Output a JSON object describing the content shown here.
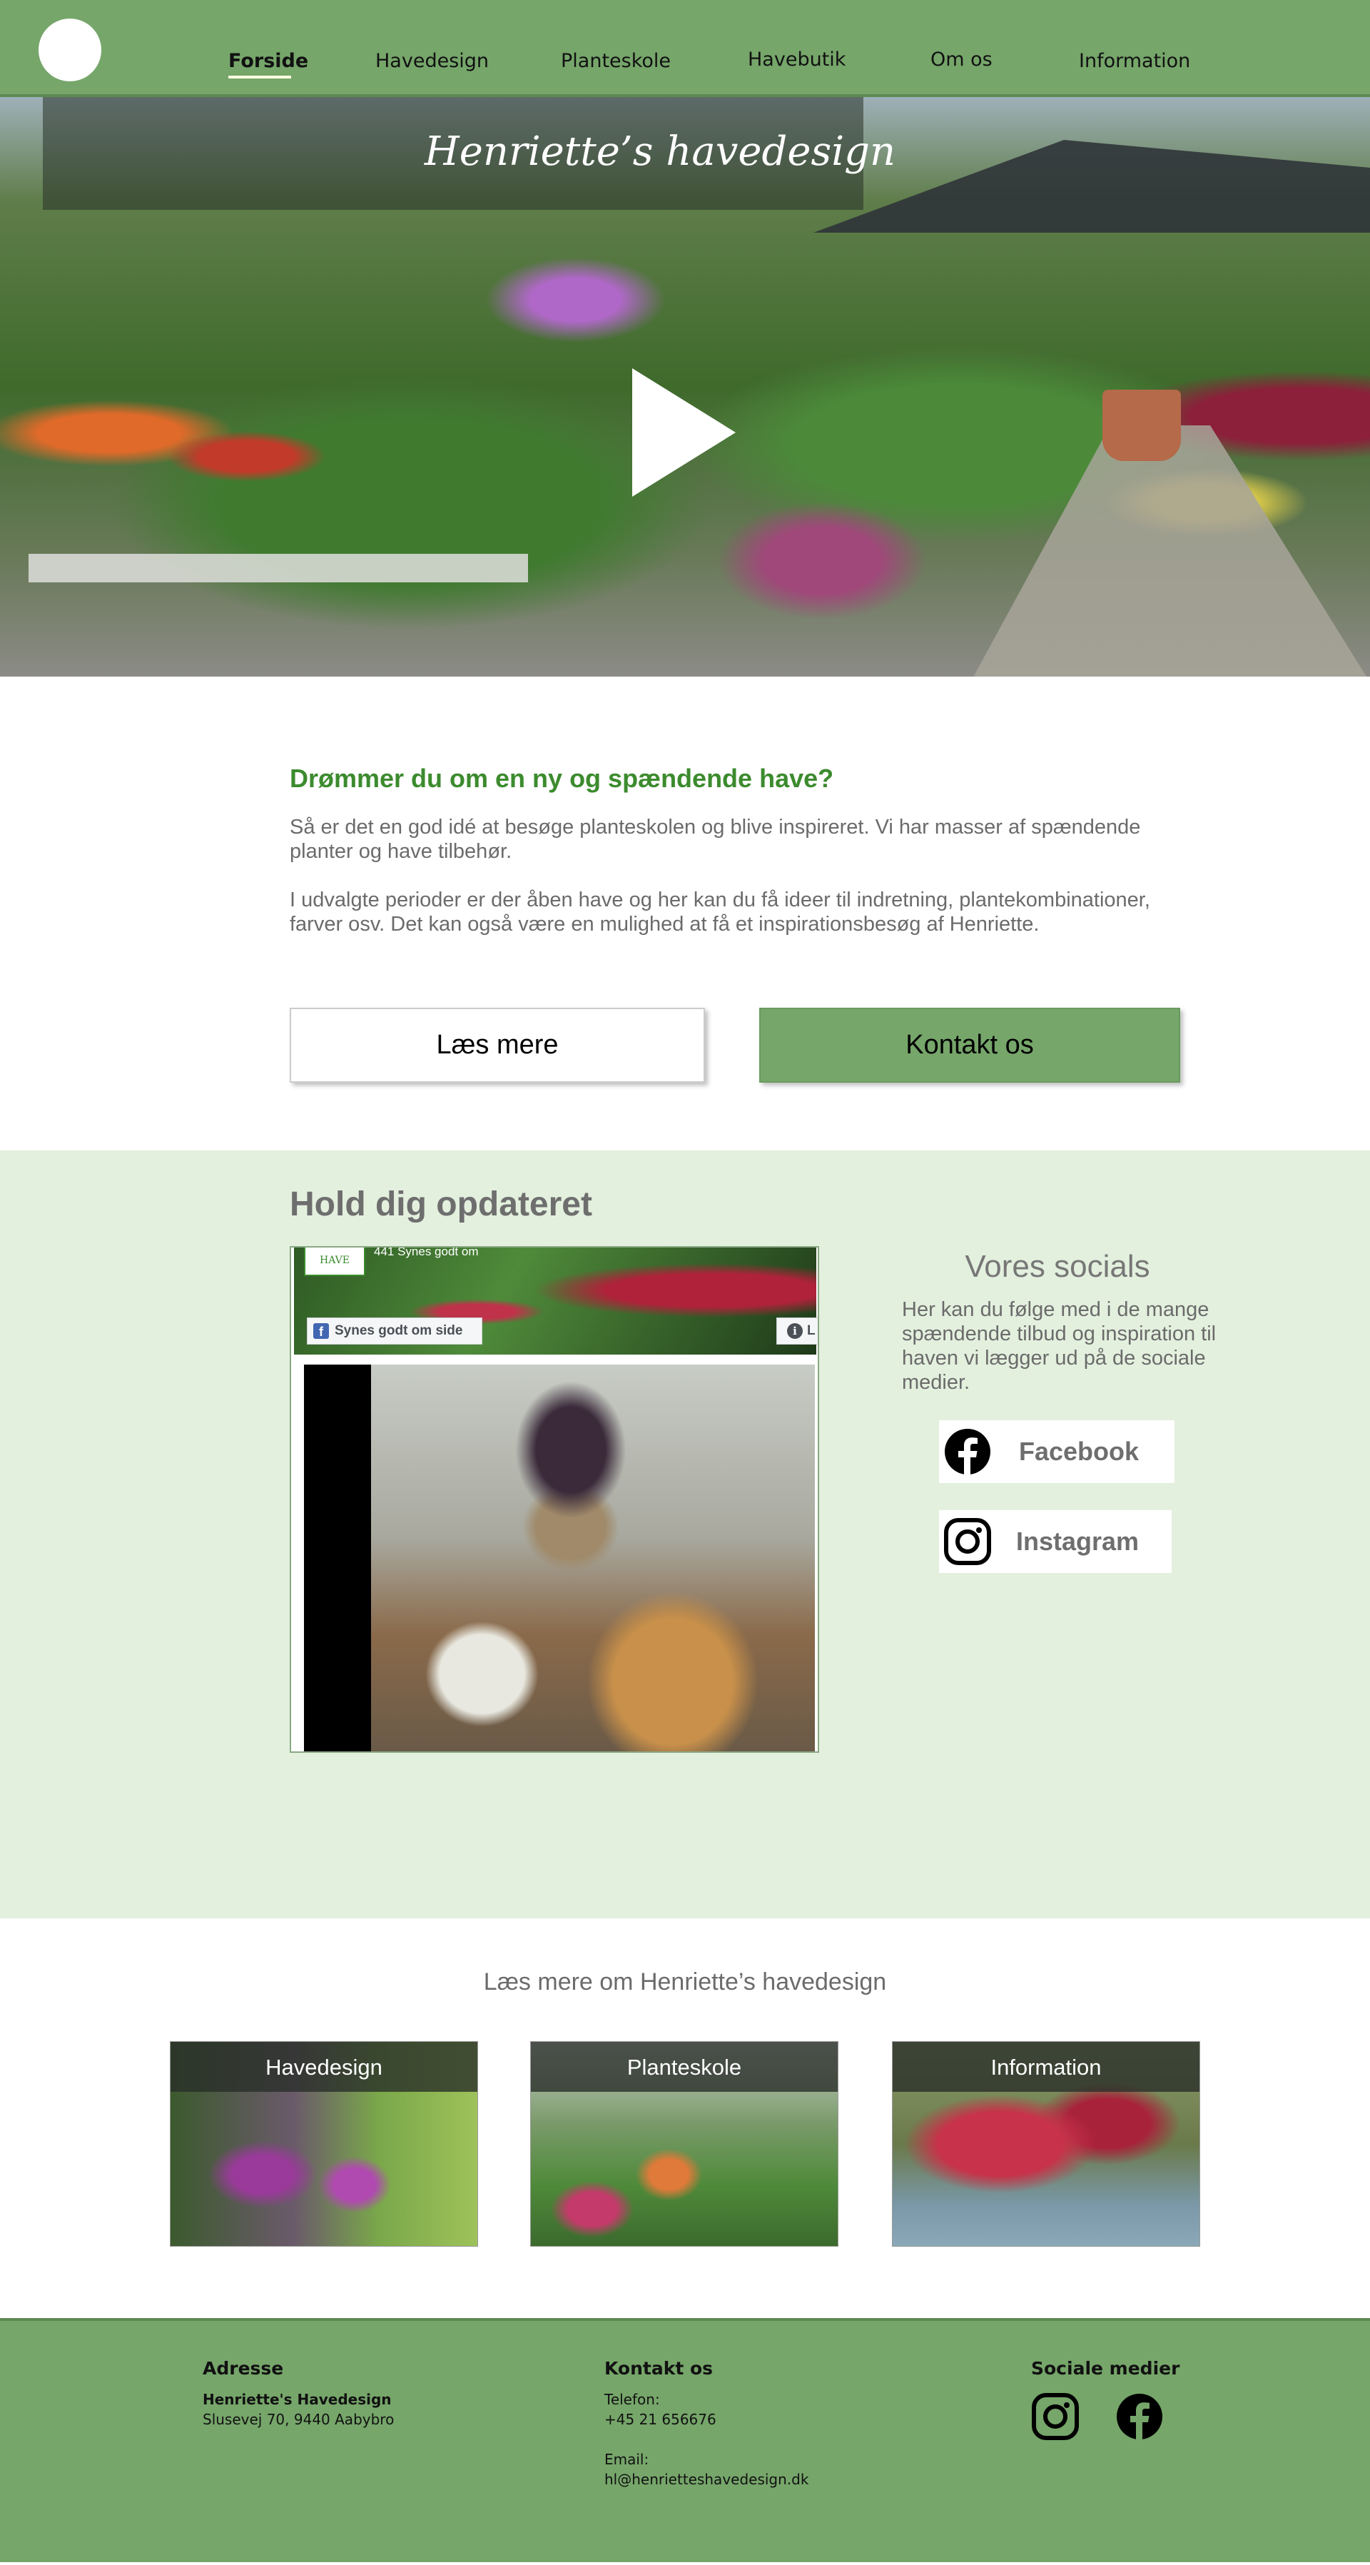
{
  "nav": {
    "items": [
      {
        "label": "Forside",
        "active": true
      },
      {
        "label": "Havedesign"
      },
      {
        "label": "Planteskole"
      },
      {
        "label": "Havebutik"
      },
      {
        "label": "Om os"
      },
      {
        "label": "Information"
      }
    ]
  },
  "hero": {
    "title": "Henriette’s havedesign",
    "play_icon": "play-icon"
  },
  "intro": {
    "heading": "Drømmer du om en ny og spændende have?",
    "paragraph1": "Så er det en god idé at besøge planteskolen og blive inspireret. Vi har masser af spændende planter og have tilbehør.",
    "paragraph2": "I udvalgte perioder er der åben have og her kan du få ideer til indretning, plantekombinationer, farver osv. Det kan også være en mulighed at få et inspirationsbesøg af Henriette.",
    "read_more_label": "Læs mere",
    "contact_label": "Kontakt os"
  },
  "updates": {
    "title": "Hold dig opdateret",
    "facebook_embed": {
      "avatar_text": "HAVE",
      "likes_text": "441 Synes godt om",
      "like_button": "Synes godt om side",
      "info_button": "L"
    },
    "socials": {
      "title": "Vores socials",
      "text": "Her kan du følge med i de mange spændende tilbud og inspiration til haven vi lægger ud på de sociale medier.",
      "facebook_label": "Facebook",
      "instagram_label": "Instagram"
    }
  },
  "read_more": {
    "title": "Læs mere om Henriette’s havedesign",
    "cards": [
      {
        "label": "Havedesign"
      },
      {
        "label": "Planteskole"
      },
      {
        "label": "Information"
      }
    ]
  },
  "footer": {
    "address_heading": "Adresse",
    "address_name": "Henriette's Havedesign",
    "address_street": "Slusevej 70, 9440 Aabybro",
    "contact_heading": "Kontakt os",
    "phone_label": "Telefon:",
    "phone": "+45 21 656676",
    "email_label": "Email:",
    "email": "hl@henrietteshavedesign.dk",
    "social_heading": "Sociale medier"
  },
  "colors": {
    "brand_green": "#76a66a",
    "light_green": "#e3f0de",
    "heading_green": "#3c8b2e"
  }
}
